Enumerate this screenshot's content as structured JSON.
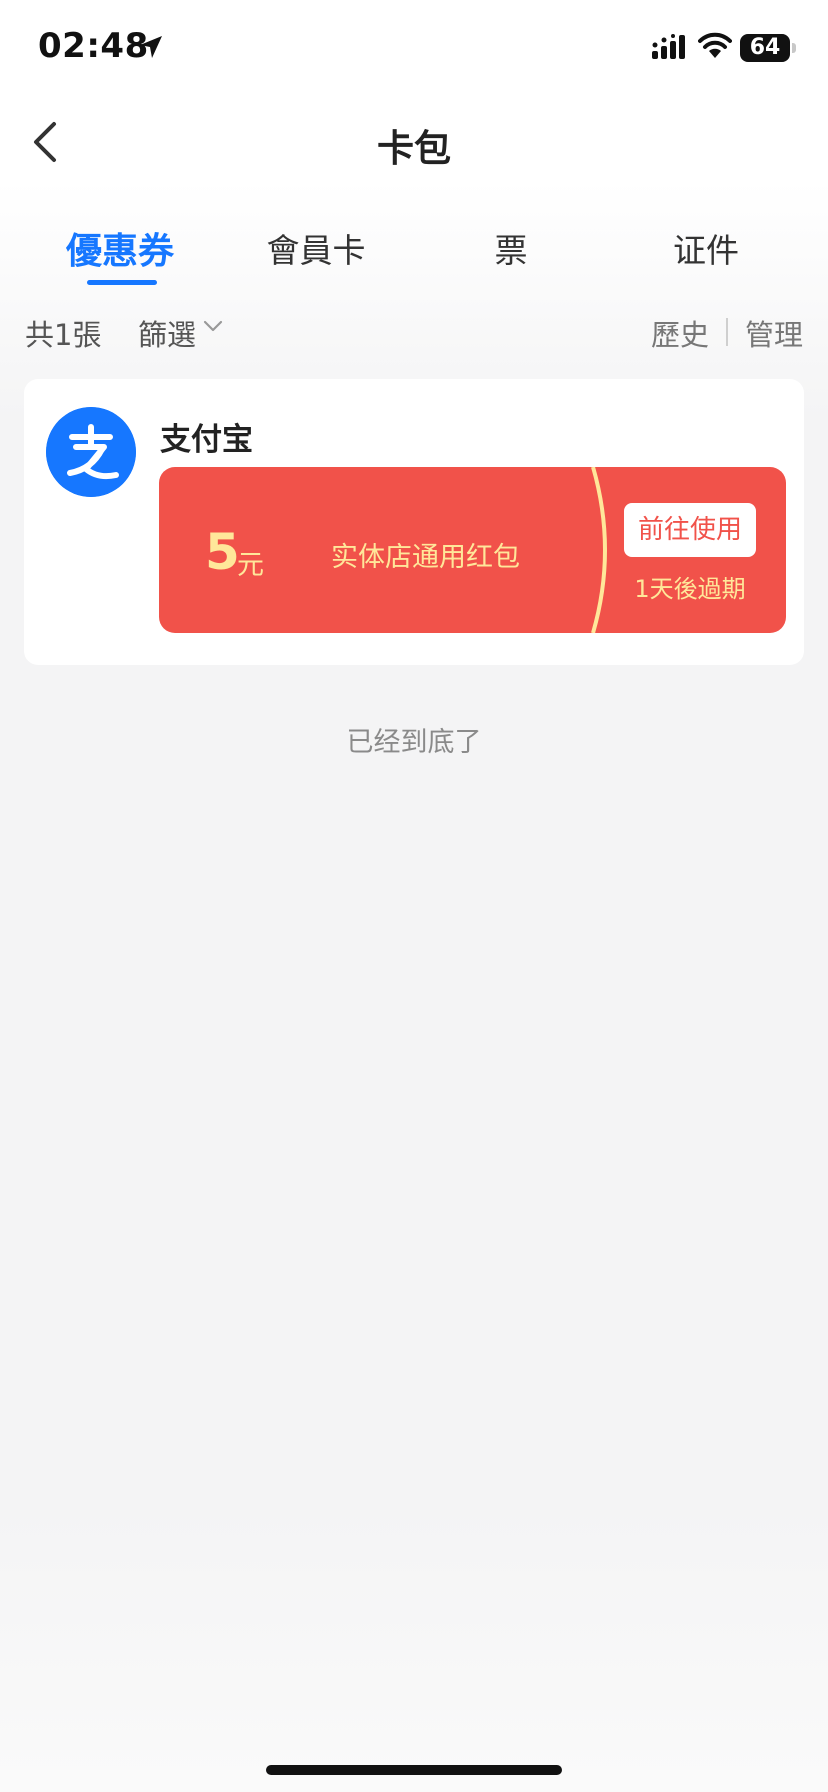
{
  "status_bar": {
    "time": "02:48",
    "battery": "64"
  },
  "nav": {
    "title": "卡包"
  },
  "tabs": [
    {
      "label": "優惠券",
      "active": true
    },
    {
      "label": "會員卡",
      "active": false
    },
    {
      "label": "票",
      "active": false
    },
    {
      "label": "证件",
      "active": false
    }
  ],
  "toolbar": {
    "count": "共1張",
    "filter": "篩選",
    "history": "歷史",
    "manage": "管理"
  },
  "coupon_card": {
    "merchant": "支付宝",
    "amount": "5",
    "unit": "元",
    "name": "实体店通用红包",
    "use_button": "前往使用",
    "expiry": "1天後過期"
  },
  "footer_note": "已经到底了",
  "colors": {
    "accent": "#1677ff",
    "coupon_bg": "#f1524a",
    "coupon_text": "#ffe79a"
  },
  "icons": [
    "location-arrow-icon",
    "cellular-signal-icon",
    "wifi-icon",
    "battery-icon",
    "back-chevron-icon",
    "chevron-down-icon",
    "alipay-logo-icon"
  ]
}
